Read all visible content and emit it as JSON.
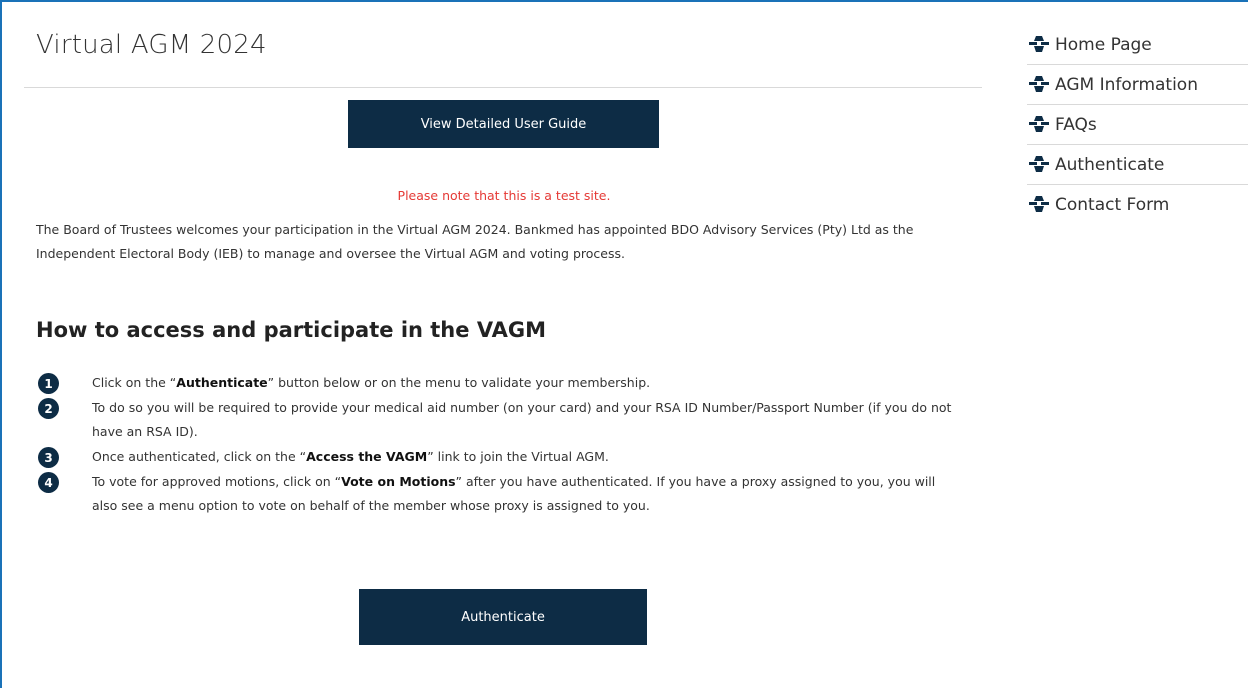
{
  "page": {
    "title": "Virtual AGM 2024",
    "accent_color": "#0d2c45",
    "frame_color": "#1a72b8",
    "note_color": "#e53935"
  },
  "guide_button": {
    "label": "View Detailed User Guide"
  },
  "note": "Please note that this is a test site.",
  "welcome_text": "The Board of Trustees welcomes your participation in the Virtual AGM 2024. Bankmed has appointed BDO Advisory Services (Pty) Ltd as the Independent Electoral Body (IEB) to manage and oversee the Virtual AGM and voting process.",
  "section": {
    "heading": "How to access and participate in the VAGM",
    "steps": [
      {
        "number": "1",
        "before": "Click on the “",
        "bold": "Authenticate",
        "after": "” button below or on the menu to validate your membership."
      },
      {
        "number": "2",
        "text": "To do so you will be required to provide your medical aid number (on your card) and your RSA ID Number/Passport Number (if you do not have an RSA ID)."
      },
      {
        "number": "3",
        "before": "Once authenticated, click on the “",
        "bold": "Access the VAGM",
        "after": "” link to join the Virtual AGM."
      },
      {
        "number": "4",
        "before": "To vote for approved motions, click on “",
        "bold": "Vote on Motions",
        "after": "” after you have authenticated. If you have a proxy assigned to you, you will also see a menu option to vote on behalf of the member whose proxy is assigned to you."
      }
    ]
  },
  "auth_button": {
    "label": "Authenticate"
  },
  "sidebar": {
    "icon": "bankmed-cross-icon",
    "items": [
      {
        "label": "Home Page"
      },
      {
        "label": "AGM Information"
      },
      {
        "label": "FAQs"
      },
      {
        "label": "Authenticate"
      },
      {
        "label": "Contact Form"
      }
    ]
  }
}
